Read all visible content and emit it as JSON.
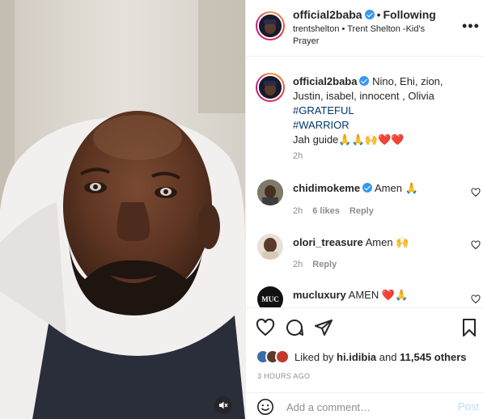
{
  "media": {
    "description_icon": "mute-icon"
  },
  "header": {
    "username": "official2baba",
    "separator": "•",
    "follow_state": "Following",
    "audio_line": "trentshelton • Trent Shelton -Kid's Prayer",
    "more_icon": "•••"
  },
  "caption": {
    "username": "official2baba",
    "text": "Nino, Ehi, zion, Justin, isabel, innocent , Olivia",
    "tag1": "#GRATEFUL",
    "tag2": "#WARRIOR",
    "closing": "Jah guide🙏🙏🙌❤️❤️",
    "time": "2h"
  },
  "comments": [
    {
      "username": "chidimokeme",
      "verified": true,
      "text": "Amen 🙏",
      "time": "2h",
      "likes": "6 likes",
      "reply": "Reply"
    },
    {
      "username": "olori_treasure",
      "verified": false,
      "text": "Amen 🙌",
      "time": "2h",
      "likes": "",
      "reply": "Reply"
    },
    {
      "username": "mucluxury",
      "verified": false,
      "text": "AMEN ❤️🙏",
      "avatar_text": "MUC"
    }
  ],
  "actions": {
    "liked_by_prefix": "Liked by",
    "liked_by_user": "hi.idibia",
    "liked_by_and": "and",
    "others": "11,545 others",
    "post_time": "3 HOURS AGO"
  },
  "comment_box": {
    "placeholder": "Add a comment…",
    "post_label": "Post"
  },
  "colors": {
    "accent": "#0095f6",
    "verified": "#3897f0",
    "heart_red": "#ed4956"
  }
}
